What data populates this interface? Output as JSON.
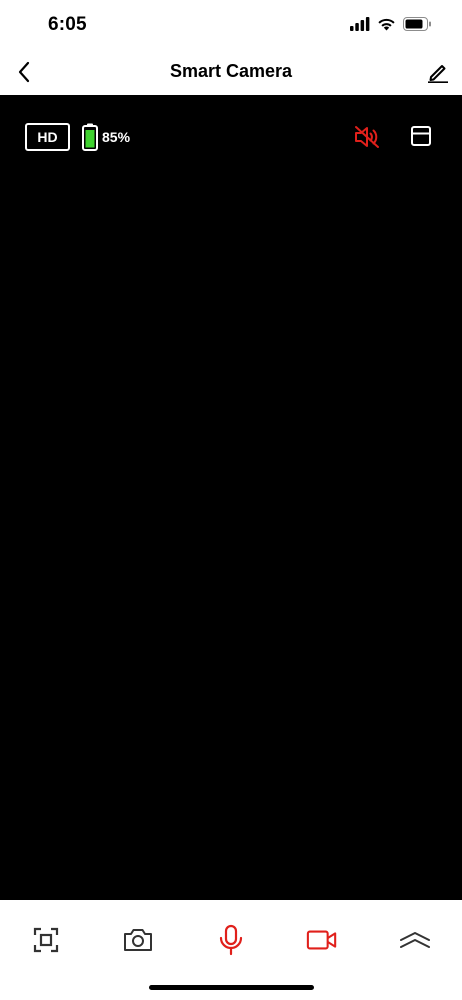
{
  "status_bar": {
    "time": "6:05",
    "icons": [
      "cellular-signal-icon",
      "wifi-icon",
      "battery-icon"
    ]
  },
  "nav": {
    "title": "Smart Camera",
    "back_icon": "chevron-left-icon",
    "edit_icon": "pencil-icon"
  },
  "video": {
    "quality_label": "HD",
    "battery_percent": "85%",
    "battery_level": 0.85,
    "mute_icon": "speaker-muted-icon",
    "layout_icon": "layout-icon"
  },
  "toolbar": {
    "items": [
      {
        "icon": "fullscreen-icon"
      },
      {
        "icon": "camera-icon"
      },
      {
        "icon": "microphone-icon"
      },
      {
        "icon": "video-record-icon"
      },
      {
        "icon": "double-chevron-up-icon"
      }
    ]
  },
  "colors": {
    "accent_red": "#e0201b",
    "battery_green": "#3fd22f",
    "video_bg": "#000000"
  }
}
